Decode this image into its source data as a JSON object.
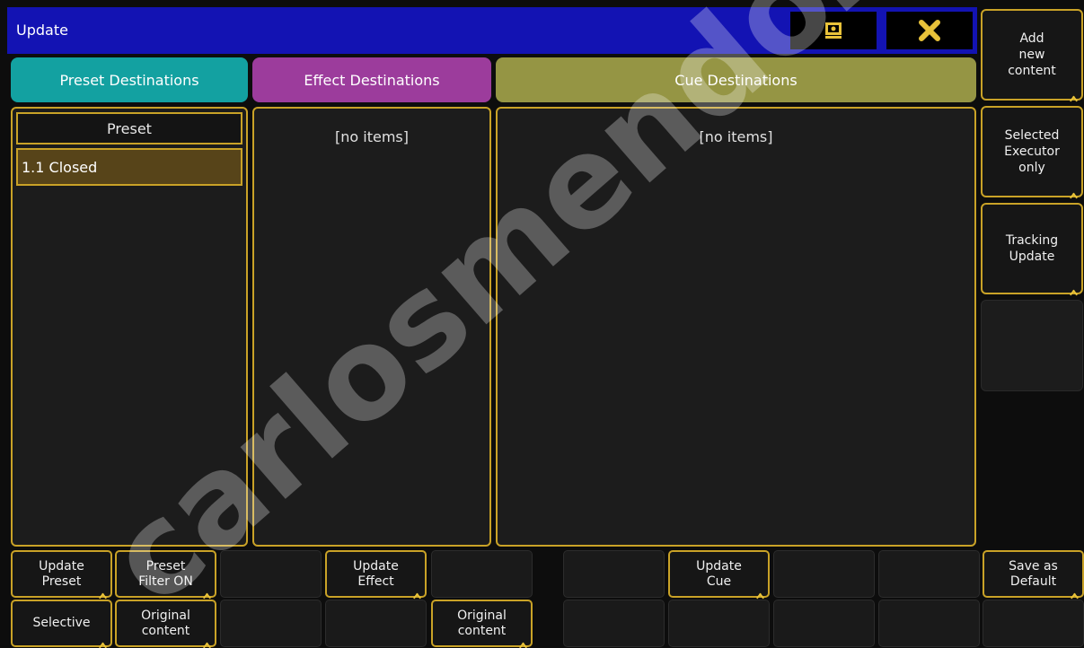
{
  "window": {
    "title": "Update",
    "buttons": [
      {
        "name": "display-icon"
      },
      {
        "name": "close-icon"
      }
    ]
  },
  "tabs": [
    {
      "label": "Preset Destinations",
      "color": "#13a1a1"
    },
    {
      "label": "Effect Destinations",
      "color": "#9c3c9c"
    },
    {
      "label": "Cue Destinations",
      "color": "#959544"
    }
  ],
  "preset_panel": {
    "header": "Preset",
    "items": [
      "1.1 Closed"
    ]
  },
  "effect_panel": {
    "empty_text": "[no items]"
  },
  "cue_panel": {
    "empty_text": "[no items]"
  },
  "side_buttons": [
    {
      "label": "Add\nnew\ncontent"
    },
    {
      "label": "Selected\nExecutor\nonly"
    },
    {
      "label": "Tracking\nUpdate"
    }
  ],
  "bottom_row1": [
    {
      "label": "Update\nPreset",
      "active": true
    },
    {
      "label": "Preset\nFilter ON",
      "active": true
    },
    {
      "label": "",
      "active": false
    },
    {
      "label": "Update\nEffect",
      "active": true
    },
    {
      "label": "",
      "active": false
    },
    {
      "label": "",
      "active": false
    },
    {
      "label": "Update\nCue",
      "active": true
    },
    {
      "label": "",
      "active": false
    },
    {
      "label": "",
      "active": false
    },
    {
      "label": "Save as\nDefault",
      "active": true
    }
  ],
  "bottom_row2": [
    {
      "label": "Selective",
      "active": true
    },
    {
      "label": "Original\ncontent",
      "active": true
    },
    {
      "label": "",
      "active": false
    },
    {
      "label": "",
      "active": false
    },
    {
      "label": "Original\ncontent",
      "active": true
    },
    {
      "label": "",
      "active": false
    },
    {
      "label": "",
      "active": false
    },
    {
      "label": "",
      "active": false
    },
    {
      "label": "",
      "active": false
    },
    {
      "label": "",
      "active": false
    }
  ],
  "watermark": "carlosmendoza",
  "colors": {
    "title_bar": "#1313b3",
    "accent": "#c9a227",
    "icon_yellow": "#e8c23a",
    "selected_row": "#574419"
  }
}
